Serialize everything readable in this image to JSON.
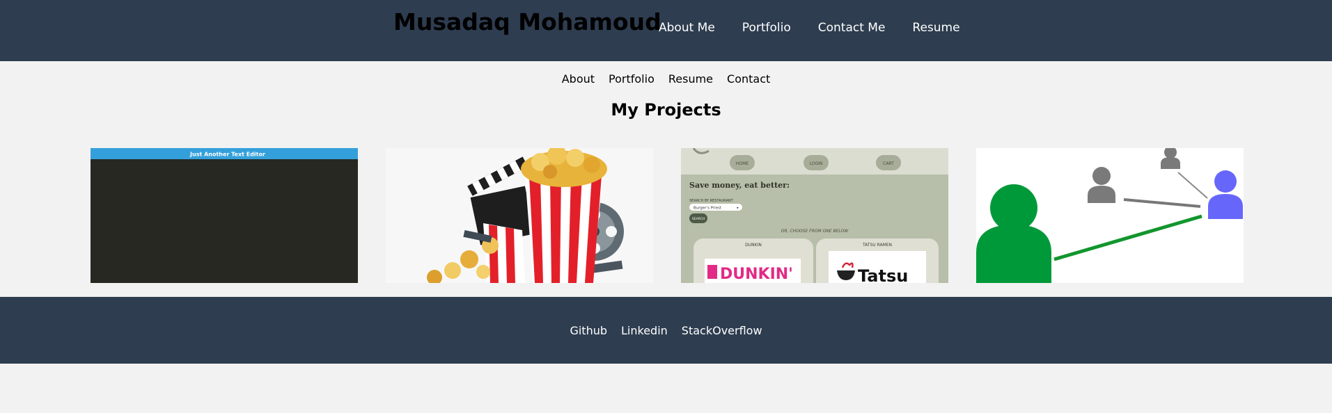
{
  "header": {
    "title": "Musadaq Mohamoud",
    "nav": [
      "About Me",
      "Portfolio",
      "Contact Me",
      "Resume"
    ]
  },
  "subnav": [
    "About",
    "Portfolio",
    "Resume",
    "Contact"
  ],
  "projects": {
    "heading": "My Projects",
    "cards": [
      {
        "preview": {
          "title_bar": "Just Another Text Editor"
        }
      },
      {
        "preview": {}
      },
      {
        "preview": {
          "nav": [
            "HOME",
            "LOGIN",
            "CART"
          ],
          "headline": "Save money, eat better:",
          "search_label": "SEARCH BY RESTAURANT",
          "select_value": "Burger's Priest",
          "search_button": "SEARCH",
          "choose_text": "OR, CHOOSE FROM ONE BELOW",
          "restaurants": [
            "DUNKIN",
            "TATSU RAMEN"
          ],
          "logo_text": [
            "DUNKIN'",
            "Tatsu"
          ]
        }
      },
      {
        "preview": {}
      }
    ]
  },
  "footer": {
    "links": [
      "Github",
      "Linkedin",
      "StackOverflow"
    ]
  },
  "colors": {
    "header_bg": "#2e3d50",
    "page_bg": "#f2f2f2",
    "editor_bar": "#34a0db",
    "editor_bg": "#272822",
    "green": "#00993a",
    "purple": "#6766fb"
  }
}
